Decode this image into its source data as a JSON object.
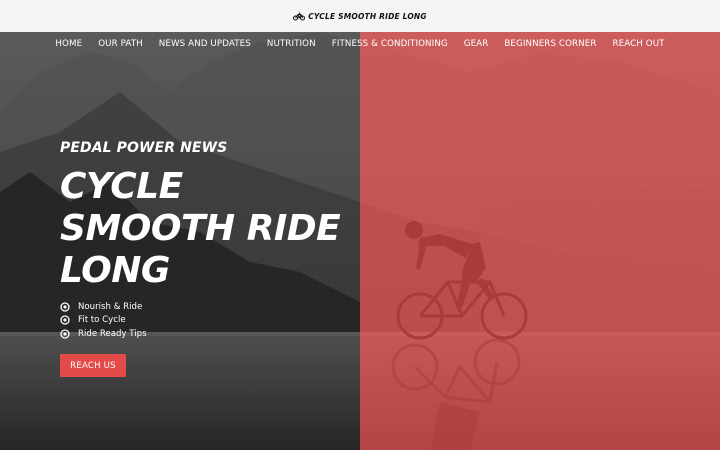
{
  "header": {
    "logo_text": "CYCLE SMOOTH RIDE LONG"
  },
  "nav": {
    "items": [
      "HOME",
      "OUR PATH",
      "NEWS AND UPDATES",
      "NUTRITION",
      "FITNESS & CONDITIONING",
      "GEAR",
      "BEGINNERS CORNER",
      "REACH OUT"
    ]
  },
  "hero": {
    "eyebrow": "PEDAL POWER NEWS",
    "headline_lines": [
      "CYCLE",
      "SMOOTH RIDE",
      "LONG"
    ],
    "features": [
      "Nourish & Ride",
      "Fit to Cycle",
      "Ride Ready Tips"
    ],
    "cta_label": "REACH US"
  },
  "colors": {
    "accent": "#e44a47",
    "topbar": "#f5f5f5",
    "overlay_right": "#e84a4a"
  },
  "icons": {
    "logo": "bicycle-icon",
    "feature_bullet": "target-icon"
  }
}
